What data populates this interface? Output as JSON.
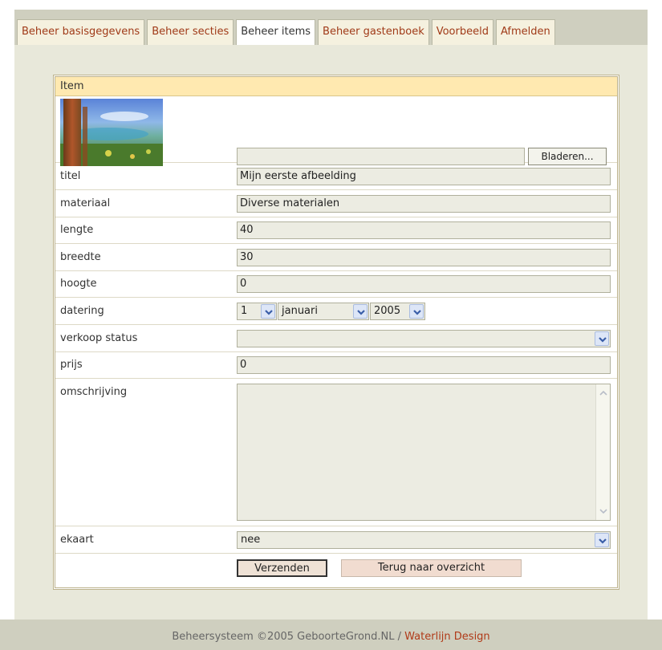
{
  "tabs": [
    {
      "label": "Beheer basisgegevens"
    },
    {
      "label": "Beheer secties"
    },
    {
      "label": "Beheer items"
    },
    {
      "label": "Beheer gastenboek"
    },
    {
      "label": "Voorbeeld"
    },
    {
      "label": "Afmelden"
    }
  ],
  "form": {
    "header": "Item",
    "browse_label": "Bladeren...",
    "fields": {
      "titel": {
        "label": "titel",
        "value": "Mijn eerste afbeelding"
      },
      "materiaal": {
        "label": "materiaal",
        "value": "Diverse materialen"
      },
      "lengte": {
        "label": "lengte",
        "value": "40"
      },
      "breedte": {
        "label": "breedte",
        "value": "30"
      },
      "hoogte": {
        "label": "hoogte",
        "value": "0"
      },
      "datering": {
        "label": "datering",
        "day": "1",
        "month": "januari",
        "year": "2005"
      },
      "verkoop_status": {
        "label": "verkoop status",
        "value": ""
      },
      "prijs": {
        "label": "prijs",
        "value": "0"
      },
      "omschrijving": {
        "label": "omschrijving",
        "value": ""
      },
      "ekaart": {
        "label": "ekaart",
        "value": "nee"
      }
    },
    "submit_label": "Verzenden",
    "back_label": "Terug naar overzicht"
  },
  "footer": {
    "text": "Beheersysteem ©2005 GeboorteGrond.NL / ",
    "link": "Waterlijn Design"
  },
  "colors": {
    "tab_text": "#a03a18",
    "header_bg": "#ffe9b0",
    "panel_bg": "#e8e8da",
    "field_bg": "#ecece2",
    "back_button_bg": "#f1dcd0"
  }
}
